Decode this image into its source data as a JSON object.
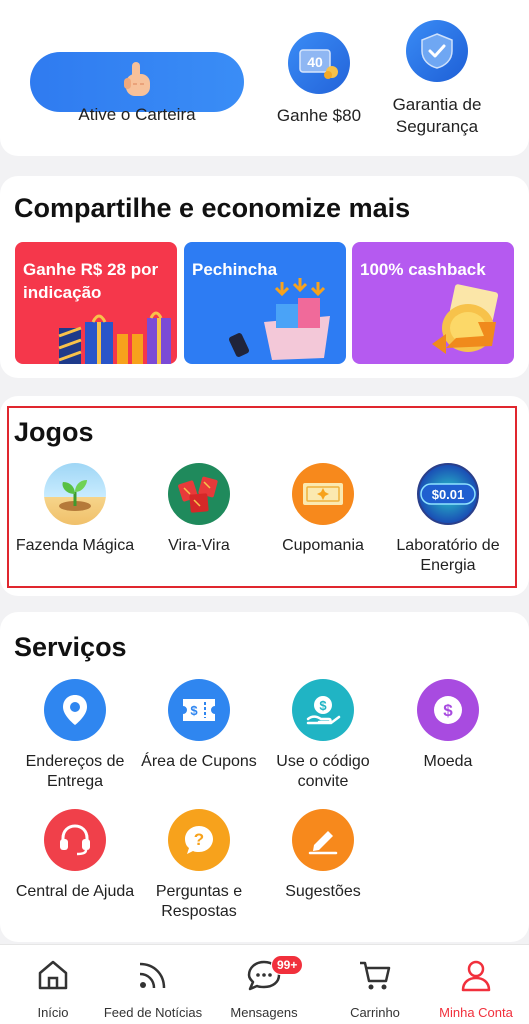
{
  "top": {
    "wallet_label": "Ative o Carteira",
    "earn_label": "Ganhe $80",
    "earn_icon_text": "40",
    "security_label": "Garantia de Segurança"
  },
  "share": {
    "title": "Compartilhe e economize mais",
    "promos": [
      {
        "label": "Ganhe R$ 28 por indicação",
        "color": "#f5374b",
        "icon": "gift-boxes-icon"
      },
      {
        "label": "Pechincha",
        "color": "#2d7cf3",
        "icon": "shopping-cart-icon"
      },
      {
        "label": "100% cashback",
        "color": "#b55af0",
        "icon": "cashback-coin-icon"
      }
    ]
  },
  "games": {
    "title": "Jogos",
    "items": [
      {
        "label": "Fazenda Mágica",
        "icon": "sprout-icon"
      },
      {
        "label": "Vira-Vira",
        "icon": "cards-icon"
      },
      {
        "label": "Cupomania",
        "icon": "coupon-icon"
      },
      {
        "label": "Laboratório de Energia",
        "icon": "energy-coin-icon",
        "icon_text": "$0.01"
      }
    ]
  },
  "services": {
    "title": "Serviços",
    "items": [
      {
        "label": "Endereços de Entrega",
        "icon": "location-pin-icon",
        "color": "#2f86f0"
      },
      {
        "label": "Área de Cupons",
        "icon": "coupon-ticket-icon",
        "color": "#2f86f0"
      },
      {
        "label": "Use o código convite",
        "icon": "hand-coin-icon",
        "color": "#20b4c4"
      },
      {
        "label": "Moeda",
        "icon": "dollar-coin-icon",
        "color": "#a84be0"
      },
      {
        "label": "Central de Ajuda",
        "icon": "headset-icon",
        "color": "#f0404a"
      },
      {
        "label": "Perguntas e Respostas",
        "icon": "question-icon",
        "color": "#f7a21c"
      },
      {
        "label": "Sugestões",
        "icon": "pen-icon",
        "color": "#f7891c"
      }
    ]
  },
  "nav": {
    "items": [
      {
        "label": "Início",
        "icon": "home-icon"
      },
      {
        "label": "Feed de Notícias",
        "icon": "feed-icon"
      },
      {
        "label": "Mensagens",
        "icon": "chat-icon",
        "badge": "99+"
      },
      {
        "label": "Carrinho",
        "icon": "cart-icon"
      },
      {
        "label": "Minha Conta",
        "icon": "user-icon",
        "active": true
      }
    ],
    "active_color": "#f1303c"
  }
}
